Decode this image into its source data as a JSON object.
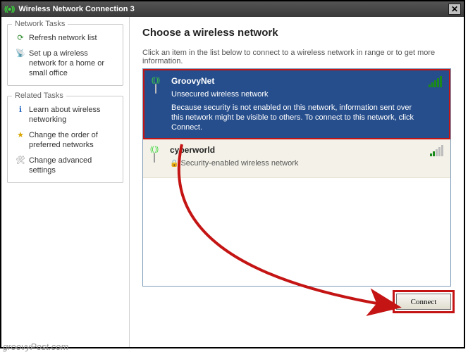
{
  "window": {
    "title": "Wireless Network Connection 3"
  },
  "sidebar": {
    "group1": {
      "title": "Network Tasks",
      "items": [
        {
          "label": "Refresh network list"
        },
        {
          "label": "Set up a wireless network for a home or small office"
        }
      ]
    },
    "group2": {
      "title": "Related Tasks",
      "items": [
        {
          "label": "Learn about wireless networking"
        },
        {
          "label": "Change the order of preferred networks"
        },
        {
          "label": "Change advanced settings"
        }
      ]
    }
  },
  "main": {
    "heading": "Choose a wireless network",
    "instruction": "Click an item in the list below to connect to a wireless network in range or to get more information.",
    "networks": [
      {
        "name": "GroovyNet",
        "subtitle": "Unsecured wireless network",
        "description": "Because security is not enabled on this network, information sent over this network might be visible to others. To connect to this network, click Connect."
      },
      {
        "name": "cyberworld",
        "subtitle": "Security-enabled wireless network"
      }
    ],
    "connect_label": "Connect"
  },
  "watermark": "groovyPost.com"
}
